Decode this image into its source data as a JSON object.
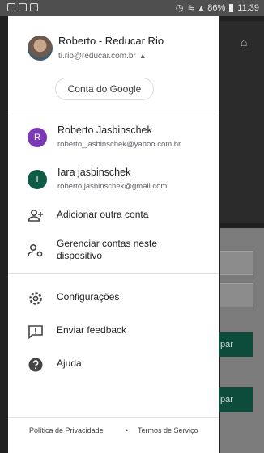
{
  "status_bar": {
    "battery": "86%",
    "time": "11:39"
  },
  "primary_account": {
    "name": "Roberto - Reducar Rio",
    "email": "ti.rio@reducar.com.br",
    "google_account_button": "Conta do Google"
  },
  "other_accounts": [
    {
      "initial": "R",
      "name": "Roberto Jasbinschek",
      "email": "roberto_jasbinschek@yahoo.com.br",
      "color": "#7b3ab5"
    },
    {
      "initial": "I",
      "name": "Iara jasbinschek",
      "email": "roberto.jasbinschek@gmail.com",
      "color": "#0f5b45"
    }
  ],
  "account_actions": {
    "add_account": "Adicionar outra conta",
    "manage_accounts": "Gerenciar contas neste dispositivo"
  },
  "menu": {
    "settings": "Configurações",
    "feedback": "Enviar feedback",
    "help": "Ajuda"
  },
  "footer": {
    "privacy": "Política de Privacidade",
    "separator": "•",
    "terms": "Termos de Serviço"
  },
  "background_app": {
    "button1": "par",
    "button2": "par"
  }
}
